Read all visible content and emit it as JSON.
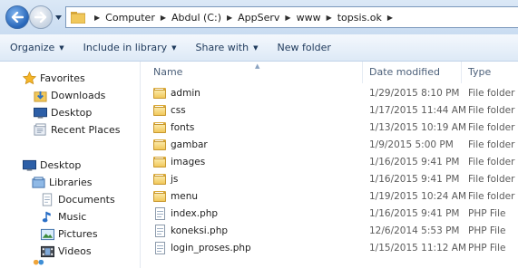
{
  "address_bar": {
    "breadcrumbs": [
      "Computer",
      "Abdul (C:)",
      "AppServ",
      "www",
      "topsis.ok"
    ]
  },
  "toolbar": {
    "organize": "Organize",
    "include_in_library": "Include in library",
    "share_with": "Share with",
    "new_folder": "New folder"
  },
  "nav_pane": {
    "favorites": {
      "label": "Favorites",
      "icon": "star-icon"
    },
    "favorites_items": [
      {
        "label": "Downloads",
        "icon": "downloads-icon"
      },
      {
        "label": "Desktop",
        "icon": "desktop-icon"
      },
      {
        "label": "Recent Places",
        "icon": "recent-places-icon"
      }
    ],
    "desktop": {
      "label": "Desktop",
      "icon": "desktop-icon"
    },
    "libraries": {
      "label": "Libraries",
      "icon": "libraries-icon"
    },
    "library_items": [
      {
        "label": "Documents",
        "icon": "documents-icon"
      },
      {
        "label": "Music",
        "icon": "music-icon"
      },
      {
        "label": "Pictures",
        "icon": "pictures-icon"
      },
      {
        "label": "Videos",
        "icon": "videos-icon"
      }
    ]
  },
  "columns": {
    "name": "Name",
    "date_modified": "Date modified",
    "type": "Type"
  },
  "files": [
    {
      "name": "admin",
      "date": "1/29/2015 8:10 PM",
      "type": "File folder",
      "kind": "folder"
    },
    {
      "name": "css",
      "date": "1/17/2015 11:44 AM",
      "type": "File folder",
      "kind": "folder"
    },
    {
      "name": "fonts",
      "date": "1/13/2015 10:19 AM",
      "type": "File folder",
      "kind": "folder"
    },
    {
      "name": "gambar",
      "date": "1/9/2015 5:00 PM",
      "type": "File folder",
      "kind": "folder"
    },
    {
      "name": "images",
      "date": "1/16/2015 9:41 PM",
      "type": "File folder",
      "kind": "folder"
    },
    {
      "name": "js",
      "date": "1/16/2015 9:41 PM",
      "type": "File folder",
      "kind": "folder"
    },
    {
      "name": "menu",
      "date": "1/19/2015 10:24 AM",
      "type": "File folder",
      "kind": "folder"
    },
    {
      "name": "index.php",
      "date": "1/16/2015 9:41 PM",
      "type": "PHP File",
      "kind": "php"
    },
    {
      "name": "koneksi.php",
      "date": "12/6/2014 5:53 PM",
      "type": "PHP File",
      "kind": "php"
    },
    {
      "name": "login_proses.php",
      "date": "1/15/2015 11:12 AM",
      "type": "PHP File",
      "kind": "php"
    }
  ],
  "colors": {
    "accent": "#2766b9",
    "toolbar_text": "#1e395b",
    "folder": "#f1c85b"
  }
}
